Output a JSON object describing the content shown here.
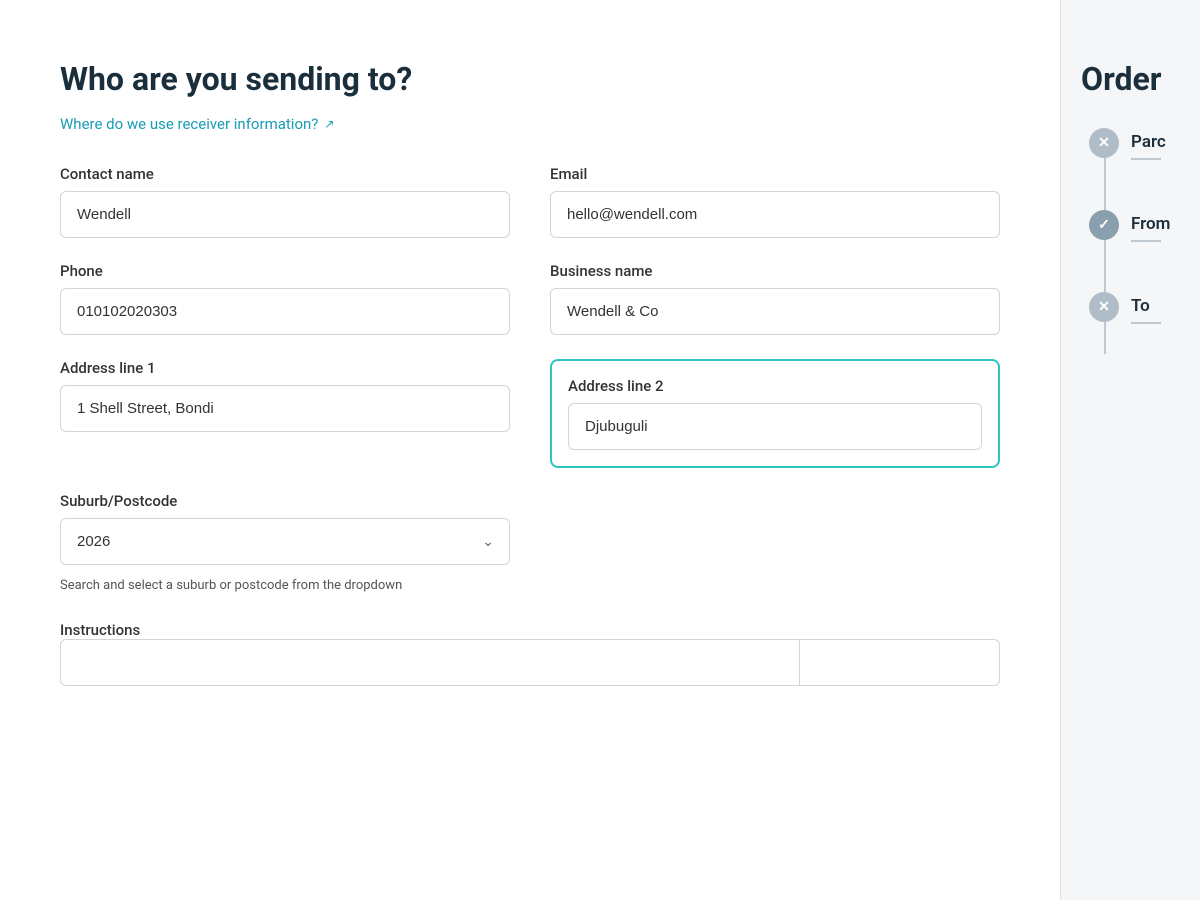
{
  "page": {
    "title": "Who are you sending to?",
    "info_link_text": "Where do we use receiver information?",
    "info_link_icon": "↗"
  },
  "form": {
    "contact_name_label": "Contact name",
    "contact_name_value": "Wendell",
    "email_label": "Email",
    "email_value": "hello@wendell.com",
    "phone_label": "Phone",
    "phone_value": "010102020303",
    "business_name_label": "Business name",
    "business_name_value": "Wendell & Co",
    "address_line1_label": "Address line 1",
    "address_line1_value": "1 Shell Street, Bondi",
    "address_line2_label": "Address line 2",
    "address_line2_value": "Djubuguli",
    "suburb_label": "Suburb/Postcode",
    "suburb_value": "2026",
    "suburb_hint": "Search and select a suburb or postcode from the dropdown",
    "instructions_label": "Instructions"
  },
  "sidebar": {
    "order_title": "Order",
    "timeline_items": [
      {
        "id": "parcel",
        "label": "Parc",
        "status": "error",
        "icon": "✕"
      },
      {
        "id": "from",
        "label": "From",
        "status": "success",
        "icon": "✓"
      },
      {
        "id": "to",
        "label": "To",
        "status": "pending",
        "icon": "✕"
      }
    ]
  }
}
